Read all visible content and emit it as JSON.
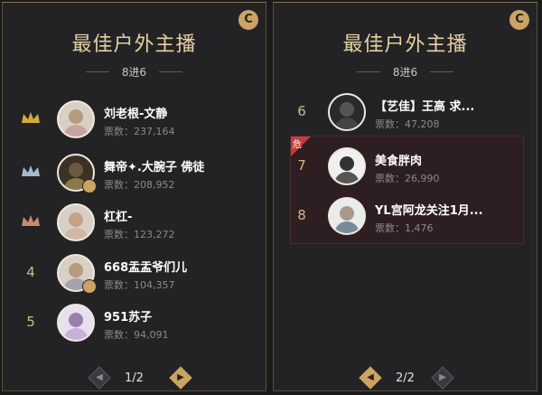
{
  "panels": [
    {
      "title": "最佳户外主播",
      "subtitle": "8进6",
      "badge": "C",
      "pager": "1/2",
      "rows": [
        {
          "rank": "",
          "medal": "gold-crown-icon",
          "name": "刘老根-文静",
          "votes": "票数：237,164"
        },
        {
          "rank": "",
          "medal": "silver-crown-icon",
          "name": "舞帝✦.大腕子 佛徒",
          "votes": "票数：208,952"
        },
        {
          "rank": "",
          "medal": "bronze-crown-icon",
          "name": "杠杠-",
          "votes": "票数：123,272"
        },
        {
          "rank": "4",
          "medal": "",
          "name": "668盂盂爷们儿",
          "votes": "票数：104,357"
        },
        {
          "rank": "5",
          "medal": "",
          "name": "951苏子",
          "votes": "票数：94,091"
        }
      ]
    },
    {
      "title": "最佳户外主播",
      "subtitle": "8进6",
      "badge": "C",
      "pager": "2/2",
      "danger_label": "危",
      "rows": [
        {
          "rank": "6",
          "name": "【艺佳】王高 求...",
          "votes": "票数：47,208"
        },
        {
          "rank": "7",
          "name": "美食胖肉",
          "votes": "票数：26,990"
        },
        {
          "rank": "8",
          "name": "YL宫阿龙关注1月...",
          "votes": "票数：1,476"
        }
      ]
    }
  ],
  "colors": {
    "gold": "#c9a464",
    "danger": "#c83a3a",
    "panel": "#232326"
  }
}
